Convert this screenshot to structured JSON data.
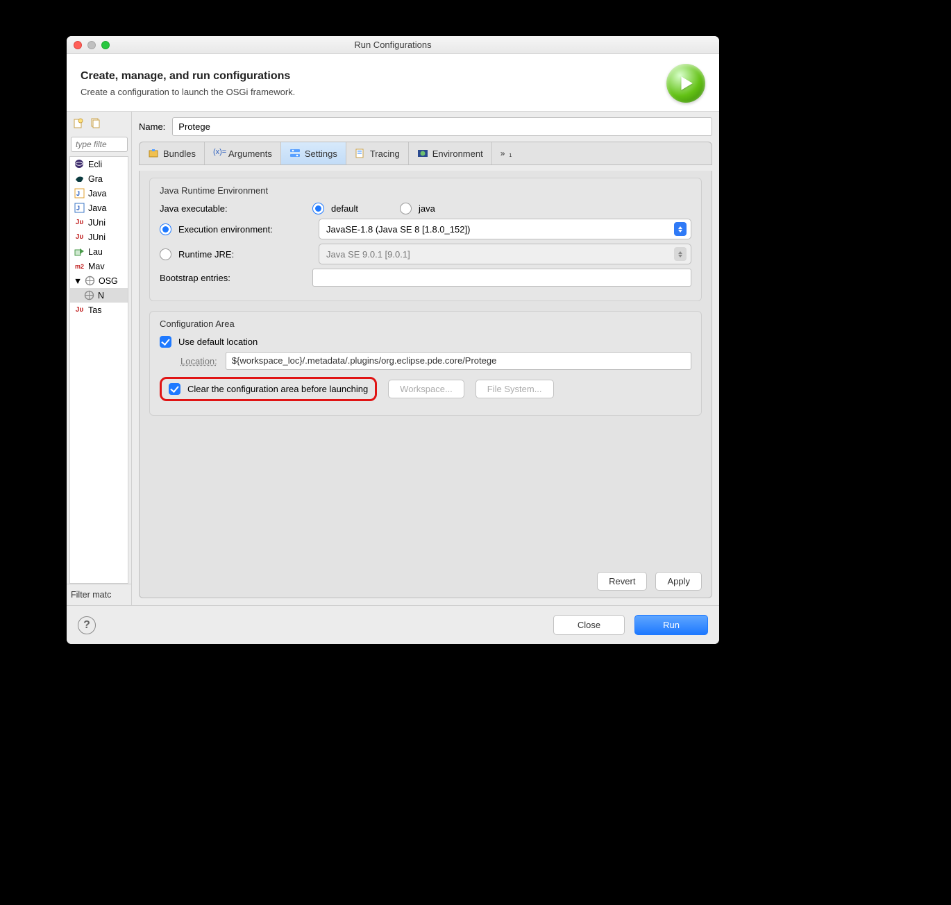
{
  "window": {
    "title": "Run Configurations"
  },
  "header": {
    "title": "Create, manage, and run configurations",
    "subtitle": "Create a configuration to launch the OSGi framework."
  },
  "sidebar": {
    "filter_placeholder": "type filte",
    "items": [
      {
        "label": "Ecli",
        "icon": "eclipse"
      },
      {
        "label": "Gra",
        "icon": "gradle"
      },
      {
        "label": "Java",
        "icon": "java-j"
      },
      {
        "label": "Java",
        "icon": "java-j"
      },
      {
        "label": "JUni",
        "icon": "junit"
      },
      {
        "label": "JUni",
        "icon": "junit"
      },
      {
        "label": "Lau",
        "icon": "launch"
      },
      {
        "label": "Mav",
        "icon": "maven"
      },
      {
        "label": "OSG",
        "icon": "osgi",
        "expanded": true
      },
      {
        "label": "N",
        "icon": "osgi-child",
        "indent": true,
        "selected": true
      },
      {
        "label": "Tas",
        "icon": "junit"
      }
    ],
    "footer": "Filter matc"
  },
  "main": {
    "name_label": "Name:",
    "name_value": "Protege",
    "tabs": [
      {
        "id": "bundles",
        "label": "Bundles"
      },
      {
        "id": "arguments",
        "label": "Arguments"
      },
      {
        "id": "settings",
        "label": "Settings",
        "active": true
      },
      {
        "id": "tracing",
        "label": "Tracing"
      },
      {
        "id": "environment",
        "label": "Environment"
      },
      {
        "id": "more",
        "label": "₁"
      }
    ],
    "jre": {
      "group_title": "Java Runtime Environment",
      "exec_label": "Java executable:",
      "exec_default": "default",
      "exec_java": "java",
      "env_label": "Execution environment:",
      "env_value": "JavaSE-1.8 (Java SE 8 [1.8.0_152])",
      "runtime_label": "Runtime JRE:",
      "runtime_value": "Java SE 9.0.1 [9.0.1]",
      "bootstrap_label": "Bootstrap entries:"
    },
    "config": {
      "group_title": "Configuration Area",
      "use_default": "Use default location",
      "location_label": "Location:",
      "location_value": "${workspace_loc}/.metadata/.plugins/org.eclipse.pde.core/Protege",
      "clear_label": "Clear the configuration area before launching",
      "workspace_btn": "Workspace...",
      "filesystem_btn": "File System..."
    },
    "revert": "Revert",
    "apply": "Apply"
  },
  "bottom": {
    "close": "Close",
    "run": "Run"
  }
}
